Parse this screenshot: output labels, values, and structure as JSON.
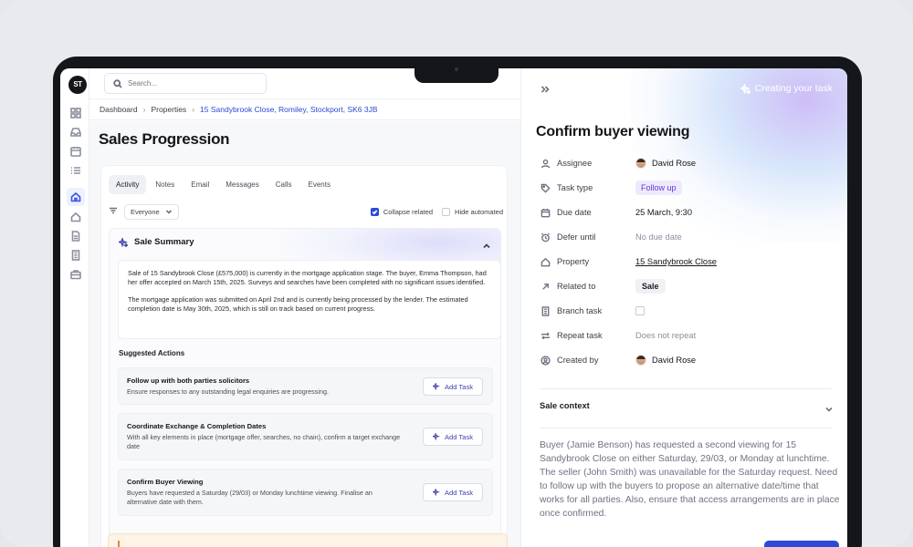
{
  "app": {
    "logo_text": "ST"
  },
  "search": {
    "placeholder": "Search..."
  },
  "breadcrumb": {
    "items": [
      "Dashboard",
      "Properties"
    ],
    "current": "15 Sandybrook Close, Romiley, Stockport, SK6 3JB"
  },
  "page": {
    "title": "Sales Progression"
  },
  "tabs": [
    "Activity",
    "Notes",
    "Email",
    "Messages",
    "Calls",
    "Events"
  ],
  "filters": {
    "audience": "Everyone",
    "collapse_related": "Collapse related",
    "hide_automated": "Hide automated"
  },
  "summary": {
    "title": "Sale Summary",
    "paragraph1": "Sale of 15 Sandybrook Close (£575,000) is currently in the mortgage application stage. The buyer, Emma Thompson, had her offer accepted on March 15th, 2025. Surveys and searches have been completed with no significant issues identified.",
    "paragraph2": "The mortgage application was submitted on April 2nd and is currently being processed by the lender. The estimated completion date is May 30th, 2025, which is still on track based on current progress."
  },
  "suggested": {
    "title": "Suggested Actions",
    "button_label": "Add Task",
    "items": [
      {
        "title": "Follow up with both parties solicitors",
        "desc": "Ensure responses to any outstanding legal enquiries are progressing."
      },
      {
        "title": "Coordinate Exchange & Completion Dates",
        "desc": "With all key elements in place (mortgage offer, searches, no chain), confirm a target exchange date"
      },
      {
        "title": "Confirm Buyer Viewing",
        "desc": "Buyers have requested a Saturday (29/03) or Monday lunchtime viewing. Finalise an alternative date with them."
      }
    ]
  },
  "panel": {
    "status": "Creating your task",
    "title": "Confirm buyer viewing",
    "props": [
      {
        "label": "Assignee",
        "value": "David Rose"
      },
      {
        "label": "Task type",
        "value": "Follow up"
      },
      {
        "label": "Due date",
        "value": "25 March, 9:30"
      },
      {
        "label": "Defer until",
        "value": "No due date"
      },
      {
        "label": "Property",
        "value": "15 Sandybrook Close"
      },
      {
        "label": "Related to",
        "value": "Sale"
      },
      {
        "label": "Branch task",
        "value": ""
      },
      {
        "label": "Repeat task",
        "value": "Does not repeat"
      },
      {
        "label": "Created by",
        "value": "David Rose"
      }
    ],
    "context_title": "Sale context",
    "context_text": "Buyer (Jamie Benson) has requested a second viewing for 15 Sandybrook Close on either Saturday, 29/03, or Monday at lunchtime. The seller (John Smith) was unavailable for the Saturday request. Need to follow up with the buyers to propose an alternative date/time that works for all parties. Also, ensure that access arrangements are in place once confirmed."
  },
  "colors": {
    "accent": "#2c49d8",
    "ai_purple": "#5b3ad1",
    "device": "#15161a"
  },
  "icons": [
    "grid-icon",
    "inbox-icon",
    "calendar-icon",
    "list-icon",
    "home-icon",
    "house-icon",
    "document-icon",
    "building-icon",
    "briefcase-icon"
  ]
}
